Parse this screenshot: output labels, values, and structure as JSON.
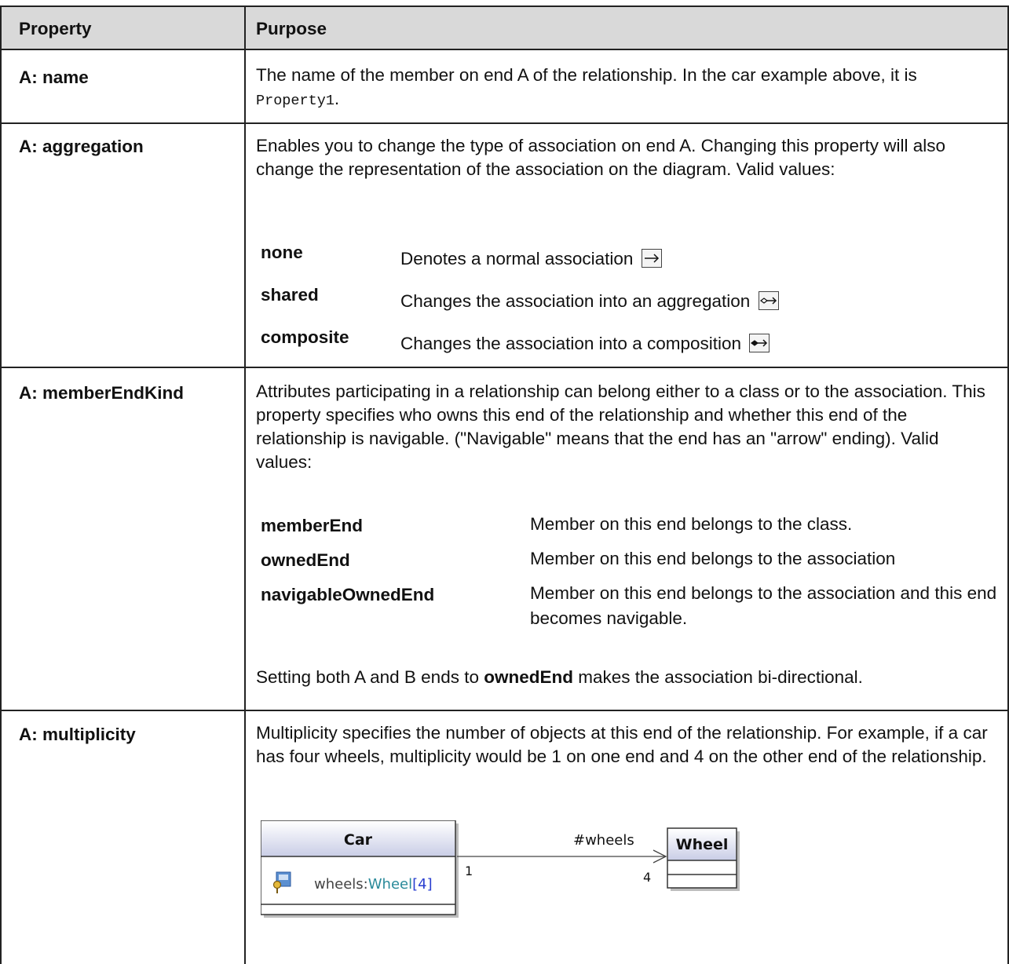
{
  "header": {
    "col1": "Property",
    "col2": "Purpose"
  },
  "rows": {
    "name": {
      "property": "A: name",
      "purpose_before": "The name of the member on end A of the relationship. In the car example above, it is ",
      "purpose_code": "Property1",
      "purpose_after": "."
    },
    "aggregation": {
      "property": "A: aggregation",
      "purpose": "Enables you to change the type of association on end A. Changing this property will also change the representation of the association on the diagram. Valid values:",
      "values": [
        {
          "name": "none",
          "description": "Denotes a normal association",
          "icon": "association-arrow-icon"
        },
        {
          "name": "shared",
          "description": "Changes the association into an aggregation",
          "icon": "aggregation-hollow-diamond-icon"
        },
        {
          "name": "composite",
          "description": "Changes the association into a composition",
          "icon": "composition-filled-diamond-icon"
        }
      ]
    },
    "memberEndKind": {
      "property": "A: memberEndKind",
      "purpose": "Attributes participating in a relationship can belong either to a class or to the association. This property specifies who owns this end of the relationship and whether this end of the relationship is navigable. (\"Navigable\" means that the end has an \"arrow\" ending). Valid values:",
      "values": [
        {
          "name": "memberEnd",
          "description": "Member on this end belongs to the class."
        },
        {
          "name": "ownedEnd",
          "description": "Member on this end belongs to the association"
        },
        {
          "name": "navigableOwnedEnd",
          "description": "Member on this end belongs to the association and this end becomes navigable."
        }
      ],
      "note_before": "Setting both A and B ends to ",
      "note_bold": "ownedEnd",
      "note_after": " makes the association bi-directional."
    },
    "multiplicity": {
      "property": "A: multiplicity",
      "purpose": "Multiplicity specifies the number of objects at this end of the relationship. For example, if a car has four wheels, multiplicity would be 1 on one end and 4 on the other end of the relationship.",
      "diagram": {
        "class_a": "Car",
        "attribute_name": "wheels:",
        "attribute_type": "Wheel",
        "attribute_mult": "[4]",
        "class_b": "Wheel",
        "role": "#wheels",
        "mult_a": "1",
        "mult_b": "4",
        "colors": {
          "header": "#c9cde6",
          "type_teal": "#2a8a9a",
          "mult_blue": "#2a3fd0"
        }
      }
    }
  }
}
